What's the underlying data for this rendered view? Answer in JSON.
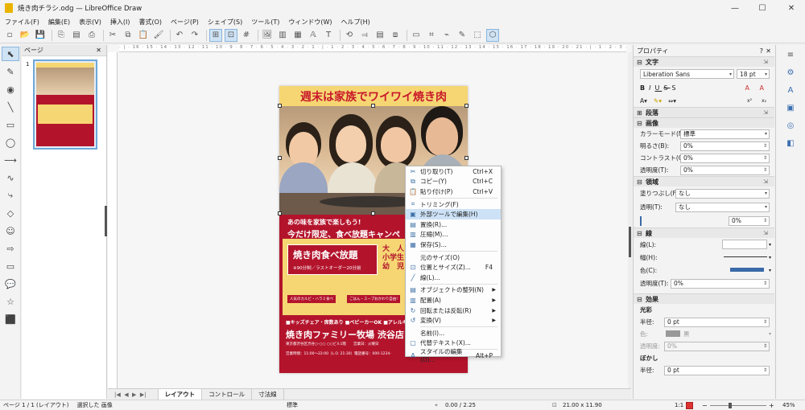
{
  "window": {
    "title": "焼き肉チラシ.odg — LibreOffice Draw"
  },
  "menu": [
    "ファイル(F)",
    "編集(E)",
    "表示(V)",
    "挿入(I)",
    "書式(O)",
    "ページ(P)",
    "シェイプ(S)",
    "ツール(T)",
    "ウィンドウ(W)",
    "ヘルプ(H)"
  ],
  "pages_panel": {
    "title": "ページ",
    "page_number": "1"
  },
  "flyer": {
    "headline": "週末は家族でワイワイ焼き肉",
    "line1": "あの味を家族で楽しもう!",
    "line2": "今だけ限定、食べ放題キャンペ",
    "plan_title": "焼き肉食べ放題",
    "plan_sub": "※90分制／ラストオーダー20分前",
    "side_text_1": "大　人",
    "side_text_2": "小学生",
    "side_text_3": "幼　児",
    "badge1": "人気のカルビ・ハラミ食べ",
    "badge2": "ごはん・スープおかわり自由!",
    "features": "■キッズチェア・席数あり ■ベビーカーOK ■アレルギ",
    "shop_name": "焼き肉ファミリー牧場 渋谷店",
    "address": "東京都渋谷区渋谷○-○○ ○○ビル1階　　営業日：火曜日",
    "hours": "営業時間：11:00～22:00（L.O. 21:30）電話番号：000-1234-"
  },
  "context_menu": [
    {
      "icon": "scissors-icon",
      "glyph": "✂",
      "label": "切り取り(T)",
      "key": "Ctrl+X"
    },
    {
      "icon": "copy-icon",
      "glyph": "⧉",
      "label": "コピー(Y)",
      "key": "Ctrl+C"
    },
    {
      "icon": "paste-icon",
      "glyph": "📋",
      "label": "貼り付け(P)",
      "key": "Ctrl+V"
    },
    {
      "sep": true
    },
    {
      "icon": "crop-icon",
      "glyph": "⌗",
      "label": "トリミング(F)",
      "key": ""
    },
    {
      "icon": "external-edit-icon",
      "glyph": "▣",
      "label": "外部ツールで編集(H)",
      "key": "",
      "hl": true
    },
    {
      "icon": "replace-icon",
      "glyph": "▤",
      "label": "置換(R)...",
      "key": ""
    },
    {
      "icon": "compress-icon",
      "glyph": "▥",
      "label": "圧縮(M)...",
      "key": ""
    },
    {
      "icon": "save-icon",
      "glyph": "▦",
      "label": "保存(S)...",
      "key": ""
    },
    {
      "sep": true
    },
    {
      "icon": "",
      "glyph": "",
      "label": "元のサイズ(O)",
      "key": ""
    },
    {
      "icon": "position-size-icon",
      "glyph": "⊡",
      "label": "位置とサイズ(Z)...",
      "key": "F4"
    },
    {
      "icon": "line-icon",
      "glyph": "╱",
      "label": "線(L)...",
      "key": ""
    },
    {
      "sep": true
    },
    {
      "icon": "arrange-icon",
      "glyph": "▤",
      "label": "オブジェクトの整列(N)",
      "key": "",
      "sub": true
    },
    {
      "icon": "align-icon",
      "glyph": "▥",
      "label": "配置(A)",
      "key": "",
      "sub": true
    },
    {
      "icon": "rotate-icon",
      "glyph": "↻",
      "label": "回転または反転(R)",
      "key": "",
      "sub": true
    },
    {
      "icon": "transform-icon",
      "glyph": "↺",
      "label": "変換(V)",
      "key": "",
      "sub": true
    },
    {
      "sep": true
    },
    {
      "icon": "",
      "glyph": "",
      "label": "名前(I)...",
      "key": ""
    },
    {
      "icon": "alt-text-icon",
      "glyph": "▢",
      "label": "代替テキスト(X)...",
      "key": ""
    },
    {
      "sep": true
    },
    {
      "icon": "style-edit-icon",
      "glyph": "A",
      "label": "スタイルの編集(D)...",
      "key": "Alt+P"
    }
  ],
  "tabs": [
    "レイアウト",
    "コントロール",
    "寸法線"
  ],
  "statusbar": {
    "page": "ページ 1 / 1 (レイアウト)",
    "selection": "選択した 画像",
    "style": "標準",
    "position": "0.00 / 2.25",
    "size": "21.00 x 11.90",
    "scale": "1:1",
    "zoom": "45%"
  },
  "sidebar": {
    "title": "プロパティ",
    "char_section": "文字",
    "font_name": "Liberation Sans",
    "font_size": "18 pt",
    "para_section": "段落",
    "image_section": "画像",
    "color_mode_label": "カラーモード(M):",
    "color_mode_value": "標準",
    "brightness_label": "明るさ(B):",
    "brightness_value": "0%",
    "contrast_label": "コントラスト(C):",
    "contrast_value": "0%",
    "transparency_label": "透明度(T):",
    "transparency_value": "0%",
    "area_section": "領域",
    "fill_label": "塗りつぶし(F):",
    "fill_value": "なし",
    "area_trans_label": "透明(T):",
    "area_trans_value": "なし",
    "area_trans_pct": "0%",
    "line_section": "線",
    "line_label": "線(L):",
    "width_label": "幅(H):",
    "color_label": "色(C):",
    "line_trans_label": "透明度(T):",
    "line_trans_value": "0%",
    "effect_section": "効果",
    "glow_label": "光彩",
    "radius_label": "半径:",
    "radius_value": "0 pt",
    "glow_color_label": "色:",
    "glow_color_value": "黒",
    "glow_trans_label": "透明度:",
    "glow_trans_value": "0%",
    "blur_label": "ぼかし",
    "blur_radius_label": "半径:",
    "blur_radius_value": "0 pt",
    "line_color": "#3a6aa8"
  }
}
